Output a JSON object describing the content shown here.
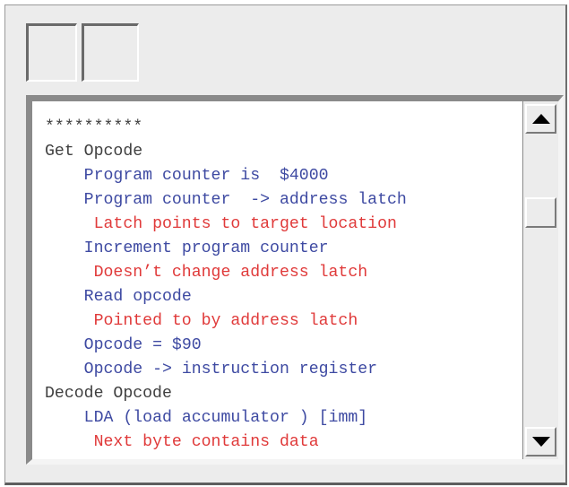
{
  "toolbar": {
    "buttons": [
      {
        "label": ""
      },
      {
        "label": ""
      }
    ]
  },
  "listing": {
    "lines": [
      {
        "indent": 0,
        "style": "heading",
        "text": "**********"
      },
      {
        "indent": 0,
        "style": "heading",
        "text": "Get Opcode"
      },
      {
        "indent": 4,
        "style": "step",
        "text": "Program counter is  $4000"
      },
      {
        "indent": 4,
        "style": "step",
        "text": "Program counter  -> address latch"
      },
      {
        "indent": 5,
        "style": "note",
        "text": "Latch points to target location"
      },
      {
        "indent": 4,
        "style": "step",
        "text": "Increment program counter"
      },
      {
        "indent": 5,
        "style": "note",
        "text": "Doesn’t change address latch"
      },
      {
        "indent": 4,
        "style": "step",
        "text": "Read opcode"
      },
      {
        "indent": 5,
        "style": "note",
        "text": "Pointed to by address latch"
      },
      {
        "indent": 4,
        "style": "step",
        "text": "Opcode = $90"
      },
      {
        "indent": 4,
        "style": "step",
        "text": "Opcode -> instruction register"
      },
      {
        "indent": 0,
        "style": "heading",
        "text": "Decode Opcode"
      },
      {
        "indent": 4,
        "style": "step",
        "text": "LDA (load accumulator ) [imm]"
      },
      {
        "indent": 5,
        "style": "note",
        "text": "Next byte contains data"
      }
    ]
  },
  "scrollbar": {
    "up_icon": "arrow-up-icon",
    "down_icon": "arrow-down-icon",
    "position": 0.24
  },
  "colors": {
    "heading": "#404040",
    "step": "#3e4aa2",
    "note": "#e03a3a"
  }
}
